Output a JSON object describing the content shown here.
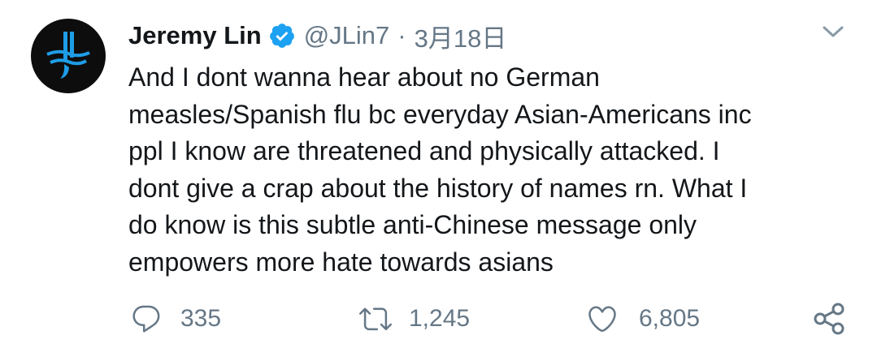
{
  "tweet": {
    "author_name": "Jeremy Lin",
    "handle": "@JLin7",
    "separator": "·",
    "date": "3月18日",
    "lines": [
      "And I dont wanna hear about no German",
      "measles/Spanish flu bc everyday Asian-Americans inc",
      "ppl I know are threatened and physically attacked. I",
      "dont give a crap about the history of names rn. What I",
      "do know is this subtle anti-Chinese message only",
      "empowers more hate towards asians"
    ]
  },
  "actions": {
    "reply_count": "335",
    "retweet_count": "1,245",
    "like_count": "6,805"
  },
  "icons": {
    "avatar": "jl-logo-avatar",
    "verified": "verified-badge-icon",
    "caret": "chevron-down-icon",
    "reply": "reply-icon",
    "retweet": "retweet-icon",
    "like": "heart-icon",
    "share": "share-icon"
  },
  "colors": {
    "text": "#14171a",
    "secondary": "#657786",
    "verified": "#1da1f2",
    "avatar_bg": "#0d0d0d",
    "logo_blue": "#1e9de6"
  }
}
